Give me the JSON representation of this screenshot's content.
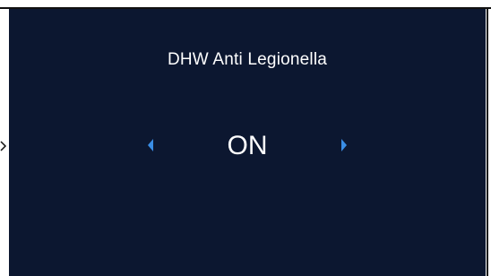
{
  "setting": {
    "title": "DHW Anti Legionella",
    "value": "ON"
  },
  "icons": {
    "prev": "chevron-left-icon",
    "next": "chevron-right-icon",
    "pointer": "pointer-arrow-icon"
  },
  "colors": {
    "screen_background": "#0c1730",
    "text": "#ffffff",
    "arrow_accent": "#3a8ee6"
  }
}
